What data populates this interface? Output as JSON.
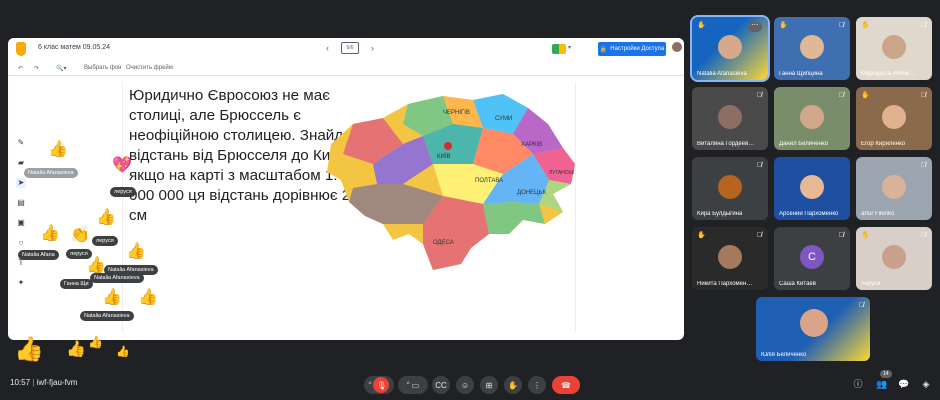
{
  "board": {
    "title": "6 клас матем 09.05.24",
    "share_label": "Настройки Доступа",
    "tools": {
      "bg_label": "Выбрать фон",
      "clear_label": "Очистить фрейм"
    },
    "slide_text": "Юридично Євросоюз не має столиці, але Брюссель є неофіційною столицею. Знайди відстань від Брюсселя до Києва, якщо на карті з масштабом 1: 10 000 000 ця відстань дорівнює 21 см",
    "map_labels": {
      "ch1": "ЧЕРНІГІВ",
      "ch2": "СУМИ",
      "ch3": "ХАРКІВ",
      "ch4": "ЛУГАНСЬК",
      "ch5": "ДОНЕЦЬК",
      "ch6": "ОДЕСА",
      "ch7": "ПОЛТАВА",
      "ch8": "КИЇВ"
    }
  },
  "reactions": {
    "tags": [
      "Natalia Afanasieva",
      "леруся",
      "Natalia Afana",
      "леруся",
      "леруся",
      "Natalia Afanasieva",
      "Natalia Afanasieva",
      "Ганна Щи",
      "Natalia Afanasieva"
    ]
  },
  "participants": [
    {
      "name": "Natalia Afanasieva",
      "color": "#1565c0"
    },
    {
      "name": "Ганна Щипцина",
      "color": "#3f6fb0"
    },
    {
      "name": "Маргарита Рябче…",
      "color": "#e0d8cc"
    },
    {
      "name": "Виталина Гордеев…",
      "color": "#4a4a4a"
    },
    {
      "name": "Данил Беличенко",
      "color": "#7a8d6b"
    },
    {
      "name": "Егор Кириленко",
      "color": "#8a6a4a"
    },
    {
      "name": "Кира Булдыгина",
      "color": "#3c4043"
    },
    {
      "name": "Арсений Пархоменко",
      "color": "#1e4fa0"
    },
    {
      "name": "artur Filenko",
      "color": "#9aa5b0"
    },
    {
      "name": "Никита Пархомен…",
      "color": "#2a2a2a"
    },
    {
      "name": "Саша Китаев",
      "color": "#3c4043",
      "initial": "С"
    },
    {
      "name": "леруся",
      "color": "#d9cfc8"
    },
    {
      "name": "Юлія Беличенко",
      "color": "#1f5fb3"
    }
  ],
  "meeting": {
    "time": "10:57",
    "code": "iwf-fjau-fvm",
    "people_count": "14"
  }
}
